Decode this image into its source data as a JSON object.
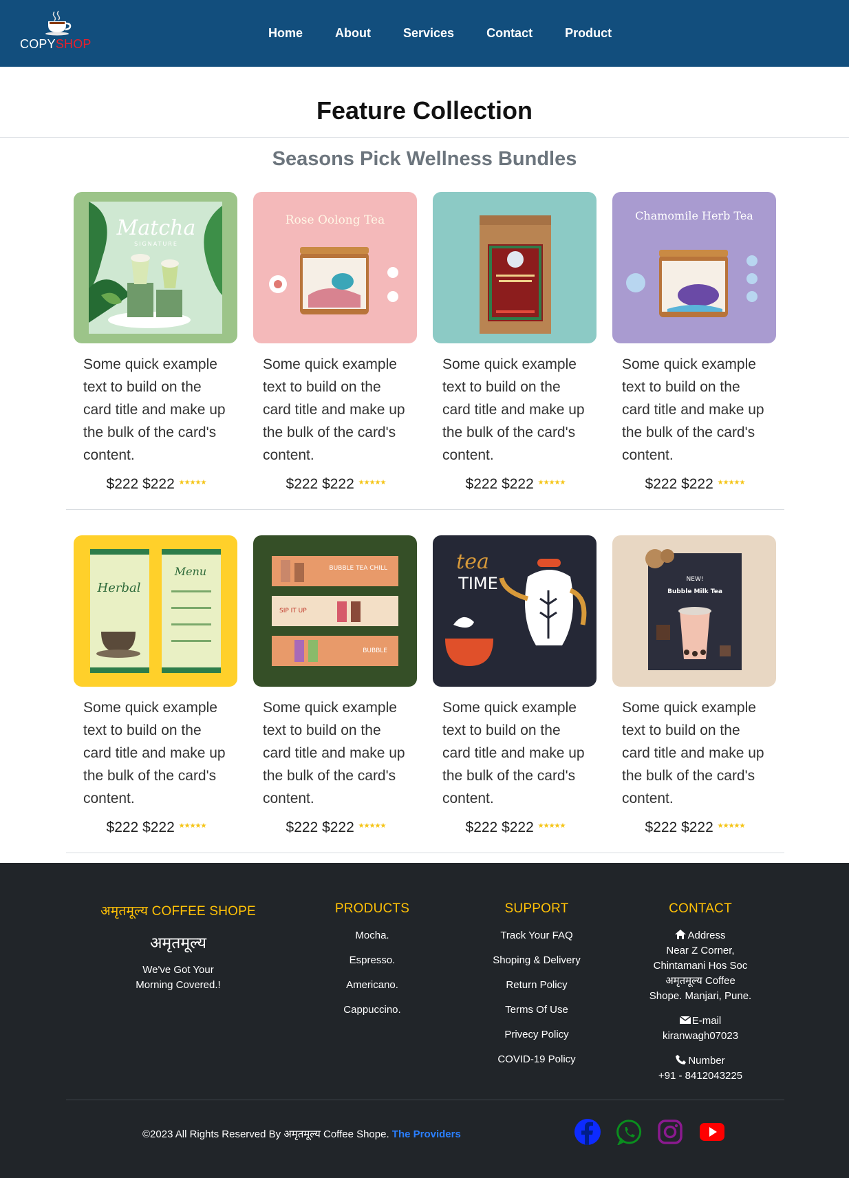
{
  "brand": {
    "prefix": "COPY",
    "suffix": "SHOP"
  },
  "nav": {
    "home": "Home",
    "about": "About",
    "services": "Services",
    "contact": "Contact",
    "product": "Product"
  },
  "page": {
    "title": "Feature Collection",
    "subtitle": "Seasons Pick Wellness Bundles"
  },
  "cards": [
    {
      "image": "matcha-signature-image",
      "image_text": "Matcha",
      "image_sub": "SIGNATURE",
      "desc": "Some quick example text to build on the card title and make up the bulk of the card's content.",
      "price": "$222",
      "old_price": "$222",
      "stars": "★★★★★"
    },
    {
      "image": "rose-oolong-tea-image",
      "image_text": "Rose Oolong Tea",
      "desc": "Some quick example text to build on the card title and make up the bulk of the card's content.",
      "price": "$222",
      "old_price": "$222",
      "stars": "★★★★★"
    },
    {
      "image": "rooibos-tea-pouch-image",
      "desc": "Some quick example text to build on the card title and make up the bulk of the card's content.",
      "price": "$222",
      "old_price": "$222",
      "stars": "★★★★★"
    },
    {
      "image": "chamomile-herb-tea-image",
      "image_text": "Chamomile Herb Tea",
      "desc": "Some quick example text to build on the card title and make up the bulk of the card's content.",
      "price": "$222",
      "old_price": "$222",
      "stars": "★★★★★"
    },
    {
      "image": "herbal-tea-menu-image",
      "desc": "Some quick example text to build on the card title and make up the bulk of the card's content.",
      "price": "$222",
      "old_price": "$222",
      "stars": "★★★★★"
    },
    {
      "image": "bubble-tea-banners-image",
      "image_text": "BUBBLE TEA CHILL",
      "desc": "Some quick example text to build on the card title and make up the bulk of the card's content.",
      "price": "$222",
      "old_price": "$222",
      "stars": "★★★★★"
    },
    {
      "image": "tea-time-kettle-image",
      "image_text": "tea TIME",
      "desc": "Some quick example text to build on the card title and make up the bulk of the card's content.",
      "price": "$222",
      "old_price": "$222",
      "stars": "★★★★★"
    },
    {
      "image": "bubble-milk-tea-image",
      "image_text": "NEW! Bubble Milk Tea",
      "desc": "Some quick example text to build on the card title and make up the bulk of the card's content.",
      "price": "$222",
      "old_price": "$222",
      "stars": "★★★★★"
    }
  ],
  "footer": {
    "shop": {
      "heading": "अमृतमूल्य COFFEE SHOPE",
      "name": "अमृतमूल्य",
      "tagline_1": "We've Got Your",
      "tagline_2": "Morning Covered.!"
    },
    "products": {
      "heading": "PRODUCTS",
      "items": [
        "Mocha.",
        "Espresso.",
        "Americano.",
        "Cappuccino."
      ]
    },
    "support": {
      "heading": "SUPPORT",
      "items": [
        "Track Your FAQ",
        "Shoping & Delivery",
        "Return Policy",
        "Terms Of Use",
        "Privecy Policy",
        "COVID-19 Policy"
      ]
    },
    "contact": {
      "heading": "CONTACT",
      "address_label": "Address",
      "address_lines": [
        "Near Z Corner,",
        "Chintamani Hos Soc",
        "अमृतमूल्य Coffee",
        "Shope. Manjari, Pune."
      ],
      "email_label": "E-mail",
      "email": "kiranwagh07023",
      "phone_label": "Number",
      "phone": "+91 - 8412043225"
    },
    "copyright": "©2023 All Rights Reserved By अमृतमूल्य Coffee Shope.",
    "providers": "The Providers",
    "social": [
      "facebook-icon",
      "whatsapp-icon",
      "instagram-icon",
      "youtube-icon"
    ],
    "social_colors": {
      "facebook": "#0d2bff",
      "whatsapp": "#0a8f1e",
      "instagram": "#8b1a8f",
      "youtube": "#ff0000"
    }
  }
}
